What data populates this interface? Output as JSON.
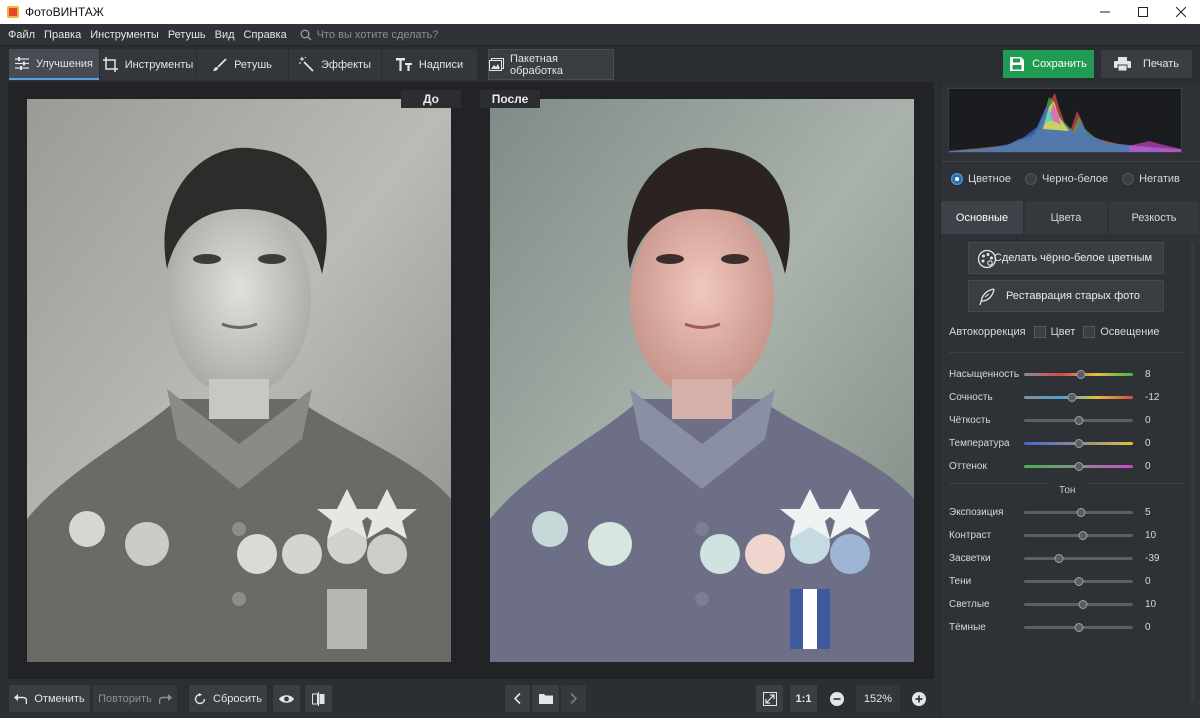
{
  "window": {
    "title": "ФотоВИНТАЖ",
    "controls": [
      "minimize-icon",
      "maximize-icon",
      "close-icon"
    ]
  },
  "menu": {
    "items": [
      "Файл",
      "Правка",
      "Инструменты",
      "Ретушь",
      "Вид",
      "Справка"
    ],
    "search_placeholder": "Что вы хотите сделать?"
  },
  "toolbar": {
    "tabs": [
      {
        "label": "Улучшения",
        "icon": "sliders-icon",
        "active": true
      },
      {
        "label": "Инструменты",
        "icon": "crop-icon",
        "active": false
      },
      {
        "label": "Ретушь",
        "icon": "brush-icon",
        "active": false
      },
      {
        "label": "Эффекты",
        "icon": "magic-wand-icon",
        "active": false
      },
      {
        "label": "Надписи",
        "icon": "text-icon",
        "active": false
      }
    ],
    "batch_label": "Пакетная обработка",
    "save_label": "Сохранить",
    "print_label": "Печать"
  },
  "canvas": {
    "before_label": "До",
    "after_label": "После"
  },
  "bottom": {
    "undo_label": "Отменить",
    "redo_label": "Повторить",
    "reset_label": "Сбросить",
    "zoom_1to1": "1:1",
    "zoom_value": "152%"
  },
  "panel": {
    "color_modes": [
      {
        "label": "Цветное",
        "selected": true
      },
      {
        "label": "Черно-белое",
        "selected": false
      },
      {
        "label": "Негатив",
        "selected": false
      }
    ],
    "subtabs": [
      {
        "label": "Основные",
        "active": true
      },
      {
        "label": "Цвета",
        "active": false
      },
      {
        "label": "Резкость",
        "active": false
      }
    ],
    "colorize_button": "Сделать чёрно-белое цветным",
    "restore_button": "Реставрация старых фото",
    "autocorrection": {
      "label": "Автокоррекция",
      "options": [
        {
          "label": "Цвет",
          "checked": false
        },
        {
          "label": "Освещение",
          "checked": false
        }
      ]
    },
    "tone_title": "Тон",
    "color_sliders": [
      {
        "label": "Насыщенность",
        "value": "8",
        "position": 0.52,
        "gradient": "saturation"
      },
      {
        "label": "Сочность",
        "value": "-12",
        "position": 0.44,
        "gradient": "vibrance"
      },
      {
        "label": "Чёткость",
        "value": "0",
        "position": 0.5,
        "gradient": "gray"
      },
      {
        "label": "Температура",
        "value": "0",
        "position": 0.5,
        "gradient": "temperature"
      },
      {
        "label": "Оттенок",
        "value": "0",
        "position": 0.5,
        "gradient": "tint"
      }
    ],
    "tone_sliders": [
      {
        "label": "Экспозиция",
        "value": "5",
        "position": 0.52
      },
      {
        "label": "Контраст",
        "value": "10",
        "position": 0.54
      },
      {
        "label": "Засветки",
        "value": "-39",
        "position": 0.32
      },
      {
        "label": "Тени",
        "value": "0",
        "position": 0.5
      },
      {
        "label": "Светлые",
        "value": "10",
        "position": 0.54
      },
      {
        "label": "Тёмные",
        "value": "0",
        "position": 0.5
      }
    ]
  },
  "colors": {
    "accent_blue": "#5aa0e6",
    "save_green": "#1f9c51",
    "panel_bg": "#2e3136"
  }
}
